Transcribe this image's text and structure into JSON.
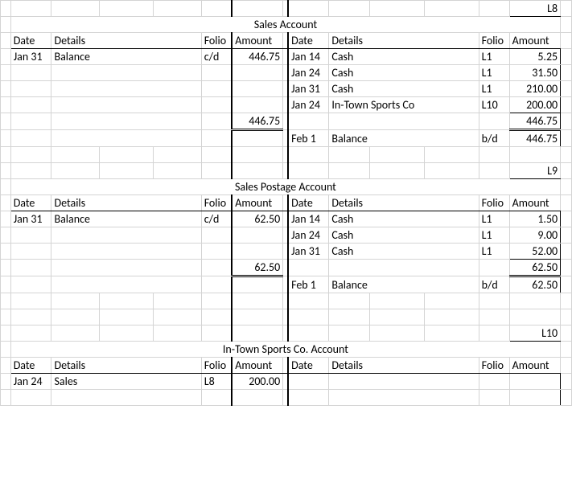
{
  "pageCodes": {
    "l8": "L8",
    "l9": "L9",
    "l10": "L10"
  },
  "headers": {
    "date": "Date",
    "details": "Details",
    "folio": "Folio",
    "amount": "Amount"
  },
  "accounts": {
    "sales": {
      "title": "Sales Account",
      "left": {
        "rows": [
          {
            "date": "Jan 31",
            "details": "Balance",
            "folio": "c/d",
            "amount": "446.75"
          }
        ],
        "total": "446.75"
      },
      "right": {
        "rows": [
          {
            "date": "Jan 14",
            "details": "Cash",
            "folio": "L1",
            "amount": "5.25"
          },
          {
            "date": "Jan 24",
            "details": "Cash",
            "folio": "L1",
            "amount": "31.50"
          },
          {
            "date": "Jan 31",
            "details": "Cash",
            "folio": "L1",
            "amount": "210.00"
          },
          {
            "date": "Jan 24",
            "details": "In-Town Sports Co",
            "folio": "L10",
            "amount": "200.00"
          }
        ],
        "total": "446.75",
        "bd": {
          "date": "Feb 1",
          "details": "Balance",
          "folio": "b/d",
          "amount": "446.75"
        }
      }
    },
    "postage": {
      "title": "Sales Postage Account",
      "left": {
        "rows": [
          {
            "date": "Jan 31",
            "details": "Balance",
            "folio": "c/d",
            "amount": "62.50"
          }
        ],
        "total": "62.50"
      },
      "right": {
        "rows": [
          {
            "date": "Jan 14",
            "details": "Cash",
            "folio": "L1",
            "amount": "1.50"
          },
          {
            "date": "Jan 24",
            "details": "Cash",
            "folio": "L1",
            "amount": "9.00"
          },
          {
            "date": "Jan 31",
            "details": "Cash",
            "folio": "L1",
            "amount": "52.00"
          }
        ],
        "total": "62.50",
        "bd": {
          "date": "Feb 1",
          "details": "Balance",
          "folio": "b/d",
          "amount": "62.50"
        }
      }
    },
    "intown": {
      "title": "In-Town Sports Co. Account",
      "left": {
        "rows": [
          {
            "date": "Jan 24",
            "details": "Sales",
            "folio": "L8",
            "amount": "200.00"
          }
        ]
      },
      "right": {
        "rows": []
      }
    }
  }
}
